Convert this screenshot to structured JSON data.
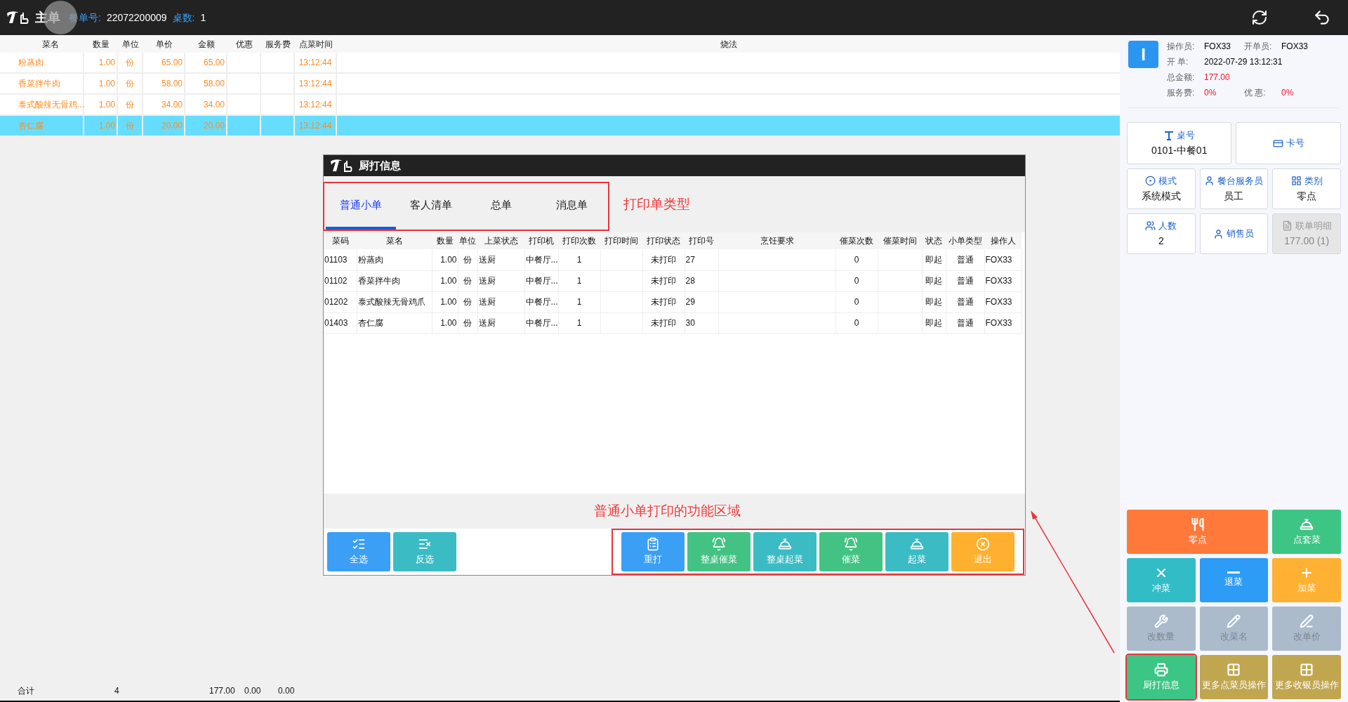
{
  "header": {
    "title": "主单",
    "order_label": "餐单号:",
    "order_no": "22072200009",
    "table_label": "桌数:",
    "table_count": "1"
  },
  "order_table": {
    "columns": [
      "菜名",
      "数量",
      "单位",
      "单价",
      "金额",
      "优惠",
      "服务费",
      "点菜时间",
      "烧法"
    ],
    "rows": [
      {
        "cells": [
          "粉蒸肉",
          "1.00",
          "份",
          "65.00",
          "65.00",
          "",
          "",
          "13:12:44"
        ],
        "selected": false
      },
      {
        "cells": [
          "香菜拌牛肉",
          "1.00",
          "份",
          "58.00",
          "58.00",
          "",
          "",
          "13:12:44"
        ],
        "selected": false
      },
      {
        "cells": [
          "泰式酸辣无骨鸡...",
          "1.00",
          "份",
          "34.00",
          "34.00",
          "",
          "",
          "13:12:44"
        ],
        "selected": false
      },
      {
        "cells": [
          "杏仁腐",
          "1.00",
          "份",
          "20.00",
          "20.00",
          "",
          "",
          "13:12:44"
        ],
        "selected": true
      }
    ]
  },
  "totals": {
    "label": "合计",
    "qty": "4",
    "amount": "177.00",
    "discount": "0.00",
    "service": "0.00"
  },
  "dialog": {
    "title": "厨打信息",
    "tabs": [
      {
        "label": "普通小单",
        "selected": true
      },
      {
        "label": "客人清单",
        "selected": false
      },
      {
        "label": "总单",
        "selected": false
      },
      {
        "label": "消息单",
        "selected": false
      }
    ],
    "tabs_note": "打印单类型",
    "columns": [
      "菜码",
      "菜名",
      "数量",
      "单位",
      "上菜状态",
      "打印机",
      "打印次数",
      "打印时间",
      "打印状态",
      "打印号",
      "烹饪要求",
      "催菜次数",
      "催菜时间",
      "状态",
      "小单类型",
      "操作人"
    ],
    "rows": [
      [
        "01103",
        "粉蒸肉",
        "1.00",
        "份",
        "送厨",
        "中餐厅...",
        "1",
        "",
        "未打印",
        "27",
        "",
        "0",
        "",
        "即起",
        "普通",
        "FOX33"
      ],
      [
        "01102",
        "香菜拌牛肉",
        "1.00",
        "份",
        "送厨",
        "中餐厅...",
        "1",
        "",
        "未打印",
        "28",
        "",
        "0",
        "",
        "即起",
        "普通",
        "FOX33"
      ],
      [
        "01202",
        "泰式酸辣无骨鸡爪",
        "1.00",
        "份",
        "送厨",
        "中餐厅...",
        "1",
        "",
        "未打印",
        "29",
        "",
        "0",
        "",
        "即起",
        "普通",
        "FOX33"
      ],
      [
        "01403",
        "杏仁腐",
        "1.00",
        "份",
        "送厨",
        "中餐厅...",
        "1",
        "",
        "未打印",
        "30",
        "",
        "0",
        "",
        "即起",
        "普通",
        "FOX33"
      ]
    ],
    "area_note": "普通小单打印的功能区域",
    "left_buttons": [
      {
        "label": "全选",
        "color": "#3a9ff5"
      },
      {
        "label": "反选",
        "color": "#3bbcc4"
      }
    ],
    "right_buttons": [
      {
        "label": "重打",
        "color": "#3a9ff5"
      },
      {
        "label": "整桌催菜",
        "color": "#43c383"
      },
      {
        "label": "整桌起菜",
        "color": "#3bbcc4"
      },
      {
        "label": "催菜",
        "color": "#43c383"
      },
      {
        "label": "起菜",
        "color": "#3bbcc4"
      },
      {
        "label": "退出",
        "color": "#ffb02e"
      }
    ]
  },
  "info": {
    "avatar": "I",
    "operator_label": "操作员:",
    "operator": "FOX33",
    "opener_label": "开单员:",
    "opener": "FOX33",
    "open_label": "开 单:",
    "open_time": "2022-07-29 13:12:31",
    "total_label": "总金额:",
    "total": "177.00",
    "service_label": "服务费:",
    "service": "0%",
    "discount_label": "优 惠:",
    "discount": "0%"
  },
  "cards": [
    {
      "label": "桌号",
      "value": "0101-中餐01",
      "disabled": false
    },
    {
      "label": "卡号",
      "disabled": false
    },
    {
      "label": "模式",
      "value": "系统模式",
      "disabled": false
    },
    {
      "label": "餐台服务员",
      "value": "员工",
      "disabled": false
    },
    {
      "label": "类别",
      "value": "零点",
      "disabled": false
    },
    {
      "label": "人数",
      "value": "2",
      "disabled": false
    },
    {
      "label": "销售员",
      "disabled": false
    },
    {
      "label": "联单明细",
      "value": "177.00 (1)",
      "disabled": true
    }
  ],
  "actions": [
    {
      "label": "零点",
      "color": "#ff7a3a",
      "wide": true,
      "disabled": false,
      "outlined": false
    },
    {
      "label": "点套菜",
      "color": "#3cc584",
      "wide": false,
      "disabled": false,
      "outlined": false
    },
    {
      "label": "冲菜",
      "color": "#32bcc6",
      "wide": false,
      "disabled": false,
      "outlined": false
    },
    {
      "label": "退菜",
      "color": "#2c9cf6",
      "wide": false,
      "disabled": false,
      "outlined": false
    },
    {
      "label": "加菜",
      "color": "#ffb133",
      "wide": false,
      "disabled": false,
      "outlined": false
    },
    {
      "label": "改数量",
      "color": "#abbbcc",
      "wide": false,
      "disabled": true,
      "outlined": false
    },
    {
      "label": "改菜名",
      "color": "#abbbcc",
      "wide": false,
      "disabled": true,
      "outlined": false
    },
    {
      "label": "改单价",
      "color": "#abbbcc",
      "wide": false,
      "disabled": true,
      "outlined": false
    },
    {
      "label": "厨打信息",
      "color": "#3cc584",
      "wide": false,
      "disabled": false,
      "outlined": true
    },
    {
      "label": "更多点菜员操作",
      "color": "#c0a64f",
      "wide": false,
      "disabled": false,
      "outlined": false
    },
    {
      "label": "更多收银员操作",
      "color": "#c0a64f",
      "wide": false,
      "disabled": false,
      "outlined": false
    }
  ]
}
